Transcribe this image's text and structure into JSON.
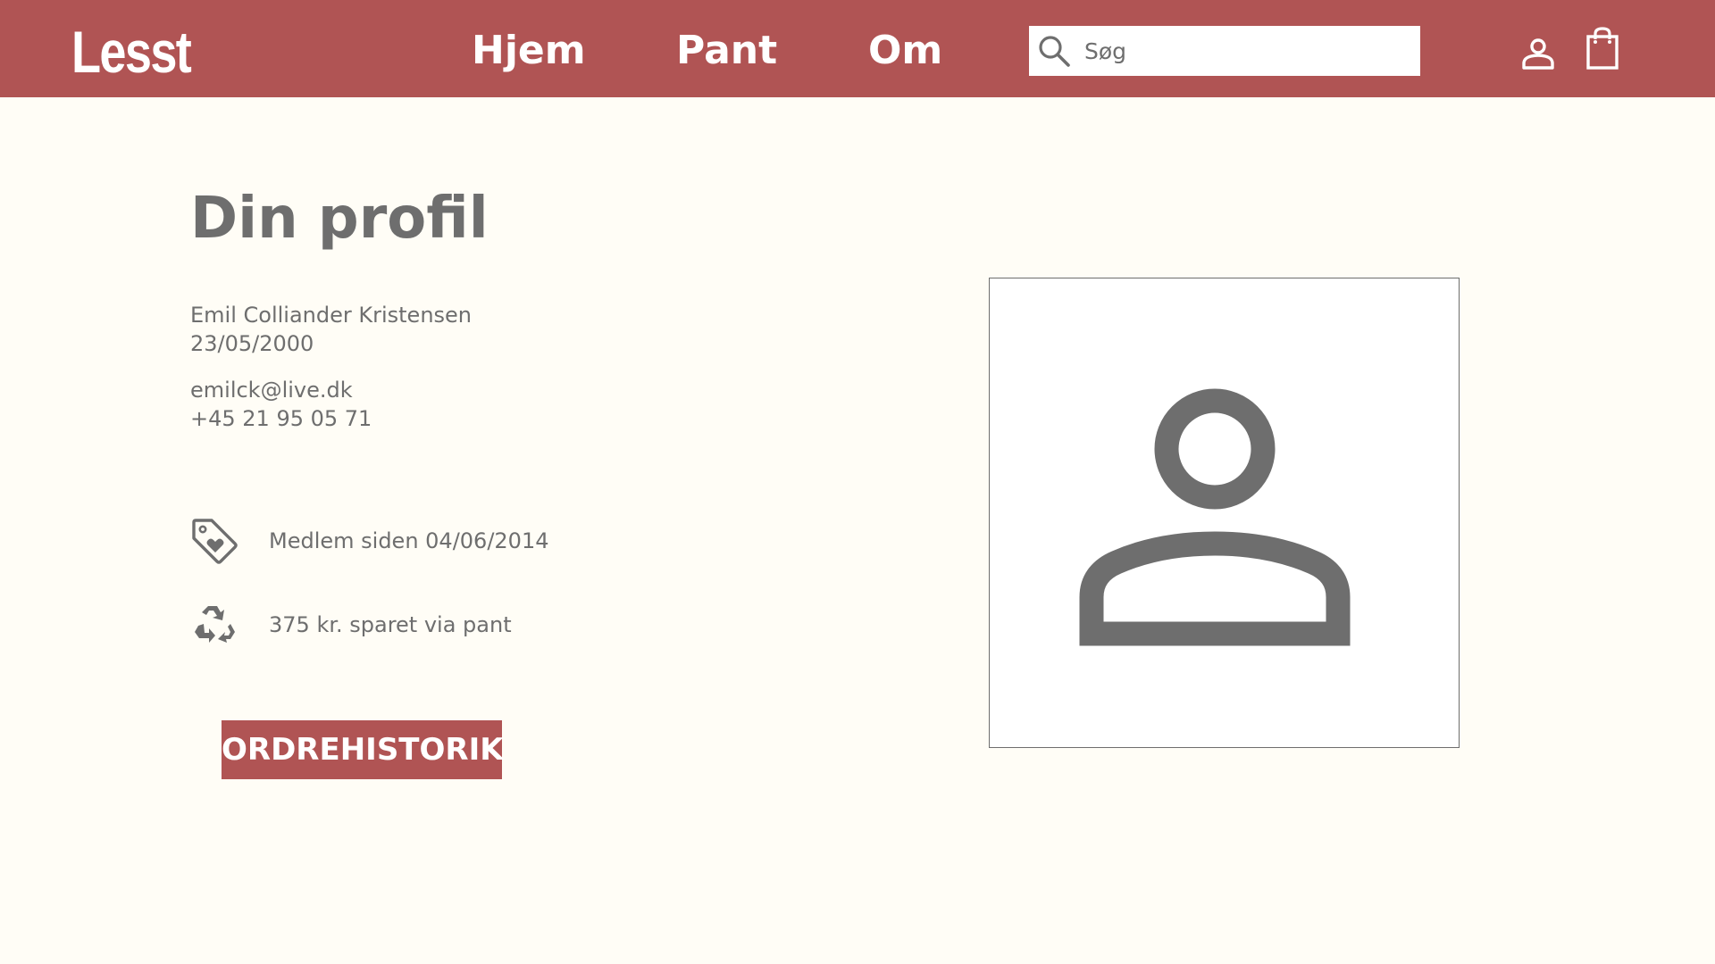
{
  "header": {
    "logo": "Lesst",
    "nav": {
      "home": "Hjem",
      "pant": "Pant",
      "about": "Om"
    },
    "search": {
      "placeholder": "Søg",
      "icon": "search-icon"
    },
    "icons": {
      "account": "account-icon",
      "cart": "shopping-bag-icon"
    }
  },
  "profile": {
    "title": "Din profil",
    "name": "Emil Colliander Kristensen",
    "birthdate": "23/05/2000",
    "email": "emilck@live.dk",
    "phone": "+45 21 95 05 71",
    "member_since": "Medlem siden 04/06/2014",
    "saved_via_pant": "375 kr. sparet via pant",
    "order_history_button": "ORDREHISTORIK",
    "avatar_icon": "user-avatar-icon"
  },
  "colors": {
    "brand": "#b05454",
    "background": "#fffdf6",
    "text": "#6e6e6e",
    "white": "#ffffff"
  }
}
